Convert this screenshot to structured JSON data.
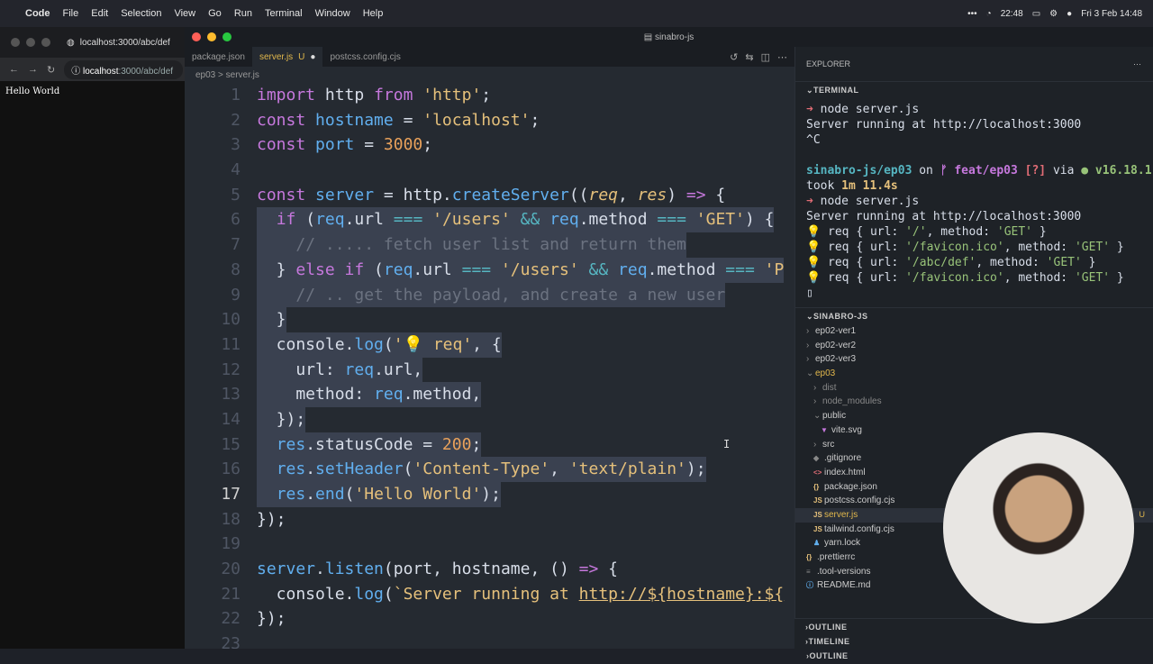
{
  "menubar": {
    "app": "Code",
    "items": [
      "File",
      "Edit",
      "Selection",
      "View",
      "Go",
      "Run",
      "Terminal",
      "Window",
      "Help"
    ],
    "time": "22:48",
    "date": "Fri 3 Feb 14:48"
  },
  "browser": {
    "tab_title": "localhost:3000/abc/def",
    "url_host": "localhost",
    "url_path": ":3000/abc/def",
    "content": "Hello World"
  },
  "vscode": {
    "window_title": "sinabro-js",
    "tabs": [
      {
        "label": "package.json"
      },
      {
        "label": "server.js",
        "badge": "U"
      },
      {
        "label": "postcss.config.cjs"
      }
    ],
    "breadcrumb": "ep03 > server.js"
  },
  "editor": {
    "lines": [
      "1",
      "2",
      "3",
      "4",
      "5",
      "6",
      "7",
      "8",
      "9",
      "10",
      "11",
      "12",
      "13",
      "14",
      "15",
      "16",
      "17",
      "18",
      "19",
      "20",
      "21",
      "22",
      "23"
    ]
  },
  "panel": {
    "explorer_label": "EXPLORER",
    "terminal_label": "TERMINAL",
    "terminal_lines": [
      "node server.js",
      "Server running at http://localhost:3000",
      "^C",
      "sinabro-js/ep03",
      "on",
      "feat/ep03",
      "[?]",
      "via",
      "v16.18.1",
      "took",
      "1m 11.4s",
      "node server.js",
      "Server running at http://localhost:3000",
      "req { url: ",
      "'/'",
      ", method: ",
      "'GET'",
      " }",
      "'/favicon.ico'",
      "'/abc/def'"
    ],
    "project_label": "SINABRO-JS",
    "tree": [
      "ep02-ver1",
      "ep02-ver2",
      "ep02-ver3",
      "ep03",
      "dist",
      "node_modules",
      "public",
      "vite.svg",
      "src",
      ".gitignore",
      "index.html",
      "package.json",
      "postcss.config.cjs",
      "server.js",
      "tailwind.config.cjs",
      "yarn.lock",
      ".prettierrc",
      ".tool-versions",
      "README.md"
    ],
    "outline_label": "OUTLINE",
    "timeline_label": "TIMELINE",
    "server_badge": "U"
  }
}
